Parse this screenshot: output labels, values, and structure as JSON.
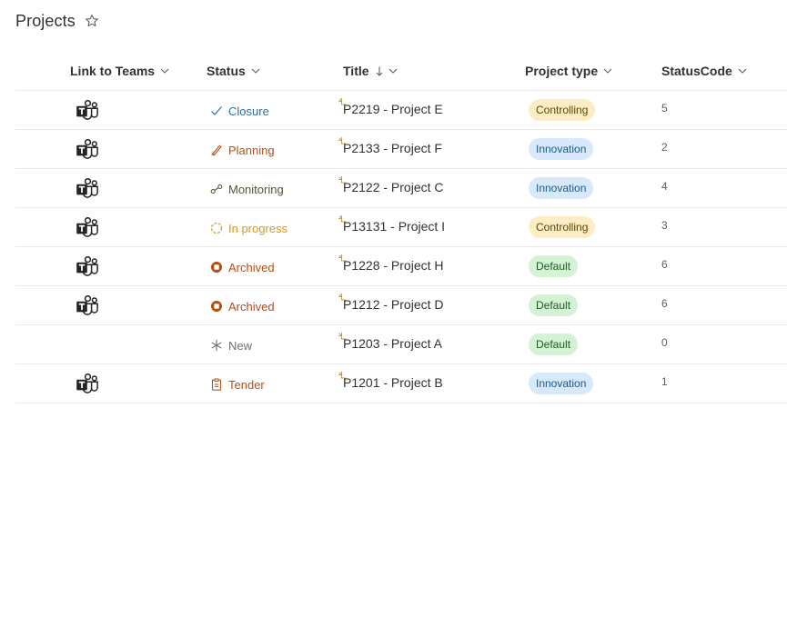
{
  "page": {
    "title": "Projects"
  },
  "columns": {
    "teams": "Link to Teams",
    "status": "Status",
    "title": "Title",
    "project_type": "Project type",
    "status_code": "StatusCode"
  },
  "colors": {
    "controlling_bg": "#fdedc4",
    "controlling_text": "#5c4400",
    "innovation_bg": "#d7e9fa",
    "innovation_text": "#1c5a8a",
    "default_bg": "#d4f2d4",
    "default_text": "#1f5c1f"
  },
  "rows": [
    {
      "has_teams": true,
      "status": "Closure",
      "status_icon": "check-icon",
      "status_color": "#2d6f9e",
      "title": "P2219 - Project E",
      "project_type": "Controlling",
      "type_key": "controlling",
      "status_code": "5"
    },
    {
      "has_teams": true,
      "status": "Planning",
      "status_icon": "pencil-icon",
      "status_color": "#b45219",
      "title": "P2133 - Project F",
      "project_type": "Innovation",
      "type_key": "innovation",
      "status_code": "2"
    },
    {
      "has_teams": true,
      "status": "Monitoring",
      "status_icon": "monitoring-icon",
      "status_color": "#4a5a3a",
      "title": "P2122 - Project C",
      "project_type": "Innovation",
      "type_key": "innovation",
      "status_code": "4"
    },
    {
      "has_teams": true,
      "status": "In progress",
      "status_icon": "progress-icon",
      "status_color": "#d69a1d",
      "title": "P13131 - Project I",
      "project_type": "Controlling",
      "type_key": "controlling",
      "status_code": "3"
    },
    {
      "has_teams": true,
      "status": "Archived",
      "status_icon": "archived-icon",
      "status_color": "#b84a14",
      "title": "P1228 - Project H",
      "project_type": "Default",
      "type_key": "default",
      "status_code": "6"
    },
    {
      "has_teams": true,
      "status": "Archived",
      "status_icon": "archived-icon",
      "status_color": "#b84a14",
      "title": "P1212 - Project D",
      "project_type": "Default",
      "type_key": "default",
      "status_code": "6"
    },
    {
      "has_teams": false,
      "status": "New",
      "status_icon": "asterisk-icon",
      "status_color": "#707070",
      "title": "P1203 - Project A",
      "project_type": "Default",
      "type_key": "default",
      "status_code": "0"
    },
    {
      "has_teams": true,
      "status": "Tender",
      "status_icon": "clipboard-icon",
      "status_color": "#b45219",
      "title": "P1201 - Project B",
      "project_type": "Innovation",
      "type_key": "innovation",
      "status_code": "1"
    }
  ]
}
